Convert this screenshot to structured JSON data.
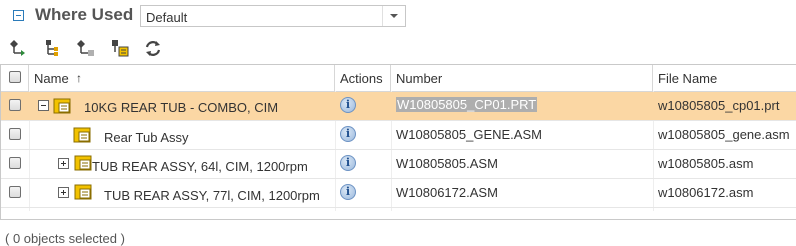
{
  "header": {
    "title": "Where Used",
    "view_select": {
      "value": "Default"
    }
  },
  "toolbar": {
    "buttons": [
      {
        "icon": "expand-tree-icon"
      },
      {
        "icon": "hierarchy-icon"
      },
      {
        "icon": "collapse-tree-icon"
      },
      {
        "icon": "structure-icon"
      },
      {
        "icon": "refresh-icon"
      }
    ]
  },
  "table": {
    "columns": {
      "name": "Name",
      "sort_indicator": "↑",
      "actions": "Actions",
      "number": "Number",
      "file_name": "File Name"
    },
    "rows": [
      {
        "name": "10KG REAR TUB - COMBO, CIM",
        "number": "W10805805_CP01.PRT",
        "file_name": "w10805805_cp01.prt",
        "selected": true
      },
      {
        "name": "Rear Tub Assy",
        "number": "W10805805_GENE.ASM",
        "file_name": "w10805805_gene.asm"
      },
      {
        "name": "TUB REAR ASSY, 64l, CIM, 1200rpm",
        "number": "W10805805.ASM",
        "file_name": "w10805805.asm"
      },
      {
        "name": "TUB REAR ASSY, 77l, CIM, 1200rpm",
        "number": "W10806172.ASM",
        "file_name": "w10806172.asm"
      }
    ]
  },
  "status": {
    "text": "( 0 objects selected )"
  },
  "colors": {
    "selected_row": "#fbd7a4",
    "accent": "#2b7bb9",
    "number_highlight": "#aeaeae"
  }
}
